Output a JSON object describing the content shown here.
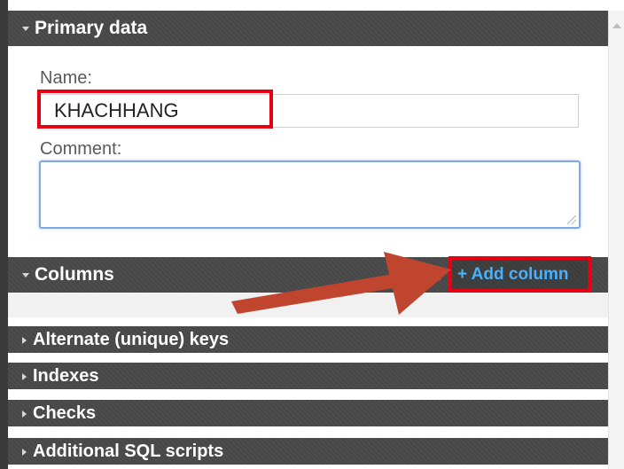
{
  "sections": {
    "primary": {
      "title": "Primary data"
    },
    "columns": {
      "title": "Columns",
      "add_label": "+ Add column"
    },
    "alternate_keys": {
      "title": "Alternate (unique) keys"
    },
    "indexes": {
      "title": "Indexes"
    },
    "checks": {
      "title": "Checks"
    },
    "additional_sql": {
      "title": "Additional SQL scripts"
    }
  },
  "form": {
    "name_label": "Name:",
    "name_value": "KHACHHANG",
    "comment_label": "Comment:",
    "comment_value": ""
  },
  "colors": {
    "header_bg": "#474747",
    "highlight": "#e60012",
    "link": "#46b2ff",
    "annotation_arrow": "#c0452f"
  },
  "icons": [
    "chevron-down-icon",
    "chevron-right-icon",
    "scroll-up-icon",
    "resize-grip-icon",
    "annotation-arrow"
  ]
}
